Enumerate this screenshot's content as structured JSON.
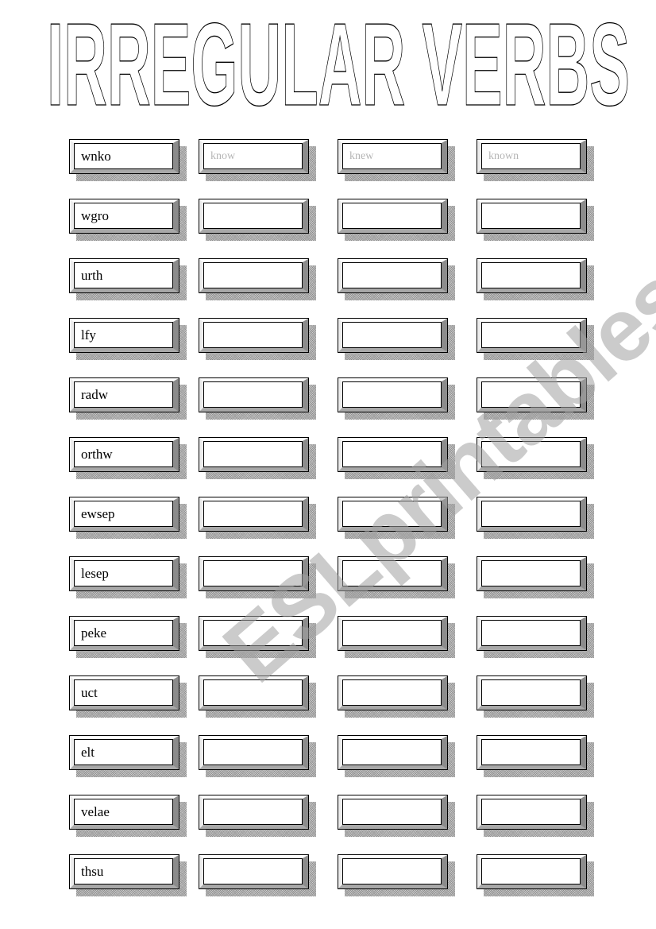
{
  "title": "IRREGULAR VERBS",
  "watermark": "ESLprintables.com",
  "columns": [
    "scrambled",
    "base_form",
    "past_simple",
    "past_participle"
  ],
  "example_row": {
    "scrambled": "wnko",
    "base_form": "know",
    "past_simple": "knew",
    "past_participle": "known"
  },
  "rows": [
    {
      "scrambled": "wnko",
      "base_form": "know",
      "past_simple": "knew",
      "past_participle": "known"
    },
    {
      "scrambled": "wgro",
      "base_form": "",
      "past_simple": "",
      "past_participle": ""
    },
    {
      "scrambled": "urth",
      "base_form": "",
      "past_simple": "",
      "past_participle": ""
    },
    {
      "scrambled": "lfy",
      "base_form": "",
      "past_simple": "",
      "past_participle": ""
    },
    {
      "scrambled": "radw",
      "base_form": "",
      "past_simple": "",
      "past_participle": ""
    },
    {
      "scrambled": "orthw",
      "base_form": "",
      "past_simple": "",
      "past_participle": ""
    },
    {
      "scrambled": "ewsep",
      "base_form": "",
      "past_simple": "",
      "past_participle": ""
    },
    {
      "scrambled": "lesep",
      "base_form": "",
      "past_simple": "",
      "past_participle": ""
    },
    {
      "scrambled": "peke",
      "base_form": "",
      "past_simple": "",
      "past_participle": ""
    },
    {
      "scrambled": "uct",
      "base_form": "",
      "past_simple": "",
      "past_participle": ""
    },
    {
      "scrambled": "elt",
      "base_form": "",
      "past_simple": "",
      "past_participle": ""
    },
    {
      "scrambled": "velae",
      "base_form": "",
      "past_simple": "",
      "past_participle": ""
    },
    {
      "scrambled": "thsu",
      "base_form": "",
      "past_simple": "",
      "past_participle": ""
    }
  ],
  "colors": {
    "example_text": "#b4b4b4",
    "border": "#000000",
    "bevel_dark": "#8c8c8c",
    "watermark": "#a0a0a0"
  }
}
